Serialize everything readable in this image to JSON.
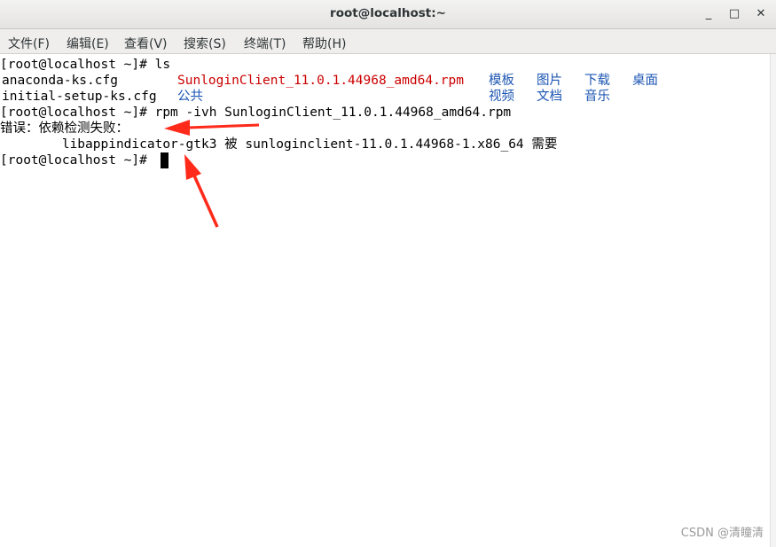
{
  "window": {
    "title": "root@localhost:~",
    "minimize_glyph": "_",
    "maximize_glyph": "□",
    "close_glyph": "✕"
  },
  "menu": [
    {
      "label": "文件(F)"
    },
    {
      "label": "编辑(E)"
    },
    {
      "label": "查看(V)"
    },
    {
      "label": "搜索(S)"
    },
    {
      "label": "终端(T)"
    },
    {
      "label": "帮助(H)"
    }
  ],
  "terminal": {
    "line1": "[root@localhost ~]# ls",
    "ls_row1": {
      "file1": "anaconda-ks.cfg",
      "rpm": "SunloginClient_11.0.1.44968_amd64.rpm",
      "dir1": "模板",
      "dir2": "图片",
      "dir3": "下载",
      "dir4": "桌面"
    },
    "ls_row2": {
      "file2": "initial-setup-ks.cfg",
      "dir5": "公共",
      "dir6": "视频",
      "dir7": "文档",
      "dir8": "音乐"
    },
    "line4": "[root@localhost ~]# rpm -ivh SunloginClient_11.0.1.44968_amd64.rpm",
    "line5": "错误：依赖检测失败：",
    "line6": "        libappindicator-gtk3 被 sunloginclient-11.0.1.44968-1.x86_64 需要",
    "line7": "[root@localhost ~]# "
  },
  "colors": {
    "rpm_file": "#cc0000",
    "directory": "#1c56b3",
    "annotation_arrow": "#ff2a1a"
  },
  "watermark": "CSDN @清瞳清"
}
